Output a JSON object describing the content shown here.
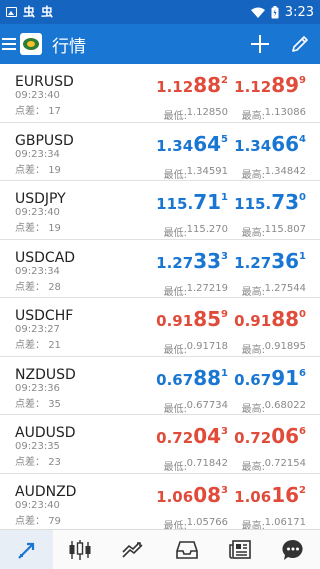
{
  "status_bar": {
    "time": "3:23",
    "left_glyphs": [
      "虫",
      "虫"
    ]
  },
  "app_bar": {
    "title": "行情"
  },
  "labels": {
    "spread": "点差：",
    "low": "最低:",
    "high": "最高:"
  },
  "colors": {
    "up": "#1976d2",
    "down": "#e04b3a",
    "app_bar": "#1976d2",
    "status_bar": "#1565c0"
  },
  "quotes": [
    {
      "symbol": "EURUSD",
      "time": "09:23:40",
      "spread": "17",
      "dir": "down",
      "bid": {
        "pre": "1.12",
        "big": "88",
        "sup": "2"
      },
      "ask": {
        "pre": "1.12",
        "big": "89",
        "sup": "9"
      },
      "low": "1.12850",
      "high": "1.13086"
    },
    {
      "symbol": "GBPUSD",
      "time": "09:23:34",
      "spread": "19",
      "dir": "up",
      "bid": {
        "pre": "1.34",
        "big": "64",
        "sup": "5"
      },
      "ask": {
        "pre": "1.34",
        "big": "66",
        "sup": "4"
      },
      "low": "1.34591",
      "high": "1.34842"
    },
    {
      "symbol": "USDJPY",
      "time": "09:23:40",
      "spread": "19",
      "dir": "up",
      "bid": {
        "pre": "115.",
        "big": "71",
        "sup": "1"
      },
      "ask": {
        "pre": "115.",
        "big": "73",
        "sup": "0"
      },
      "low": "115.270",
      "high": "115.807"
    },
    {
      "symbol": "USDCAD",
      "time": "09:23:34",
      "spread": "28",
      "dir": "up",
      "bid": {
        "pre": "1.27",
        "big": "33",
        "sup": "3"
      },
      "ask": {
        "pre": "1.27",
        "big": "36",
        "sup": "1"
      },
      "low": "1.27219",
      "high": "1.27544"
    },
    {
      "symbol": "USDCHF",
      "time": "09:23:27",
      "spread": "21",
      "dir": "down",
      "bid": {
        "pre": "0.91",
        "big": "85",
        "sup": "9"
      },
      "ask": {
        "pre": "0.91",
        "big": "88",
        "sup": "0"
      },
      "low": "0.91718",
      "high": "0.91895"
    },
    {
      "symbol": "NZDUSD",
      "time": "09:23:36",
      "spread": "35",
      "dir": "up",
      "bid": {
        "pre": "0.67",
        "big": "88",
        "sup": "1"
      },
      "ask": {
        "pre": "0.67",
        "big": "91",
        "sup": "6"
      },
      "low": "0.67734",
      "high": "0.68022"
    },
    {
      "symbol": "AUDUSD",
      "time": "09:23:35",
      "spread": "23",
      "dir": "down",
      "bid": {
        "pre": "0.72",
        "big": "04",
        "sup": "3"
      },
      "ask": {
        "pre": "0.72",
        "big": "06",
        "sup": "6"
      },
      "low": "0.71842",
      "high": "0.72154"
    },
    {
      "symbol": "AUDNZD",
      "time": "09:23:40",
      "spread": "79",
      "dir": "down",
      "bid": {
        "pre": "1.06",
        "big": "08",
        "sup": "3"
      },
      "ask": {
        "pre": "1.06",
        "big": "16",
        "sup": "2"
      },
      "low": "1.05766",
      "high": "1.06171"
    }
  ],
  "bottom_nav": {
    "items": [
      {
        "icon": "quotes-arrows-icon",
        "active": true
      },
      {
        "icon": "candlestick-chart-icon",
        "active": false
      },
      {
        "icon": "trade-icon",
        "active": false
      },
      {
        "icon": "inbox-icon",
        "active": false
      },
      {
        "icon": "news-icon",
        "active": false
      },
      {
        "icon": "chat-icon",
        "active": false
      }
    ]
  }
}
